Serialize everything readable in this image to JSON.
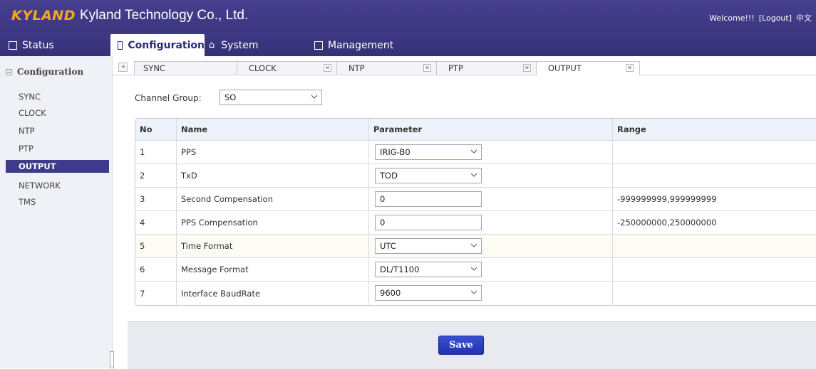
{
  "header": {
    "logo": "KYLAND",
    "company": "Kyland Technology Co., Ltd.",
    "welcome": "Welcome!!!",
    "logout": "[Logout]",
    "language": "中文"
  },
  "nav": {
    "tabs": [
      {
        "label": "Status",
        "icon": "status-icon"
      },
      {
        "label": "Configuration",
        "icon": "configuration-icon",
        "active": true
      },
      {
        "label": "System",
        "icon": "home-icon"
      },
      {
        "label": "Management",
        "icon": "management-icon"
      }
    ]
  },
  "sidebar": {
    "title": "Configuration",
    "items": [
      {
        "label": "SYNC"
      },
      {
        "label": "CLOCK"
      },
      {
        "label": "NTP"
      },
      {
        "label": "PTP"
      },
      {
        "label": "OUTPUT",
        "active": true
      },
      {
        "label": "NETWORK"
      },
      {
        "label": "TMS"
      }
    ]
  },
  "subtabs": [
    {
      "label": "SYNC"
    },
    {
      "label": "CLOCK"
    },
    {
      "label": "NTP"
    },
    {
      "label": "PTP"
    },
    {
      "label": "OUTPUT",
      "active": true
    }
  ],
  "content": {
    "channel_group_label": "Channel Group:",
    "channel_group_value": "SO",
    "table": {
      "headers": [
        "No",
        "Name",
        "Parameter",
        "Range"
      ],
      "rows": [
        {
          "no": "1",
          "name": "PPS",
          "type": "select",
          "value": "IRIG-B0",
          "range": ""
        },
        {
          "no": "2",
          "name": "TxD",
          "type": "select",
          "value": "TOD",
          "range": ""
        },
        {
          "no": "3",
          "name": "Second Compensation",
          "type": "input",
          "value": "0",
          "range": "-999999999,999999999"
        },
        {
          "no": "4",
          "name": "PPS Compensation",
          "type": "input",
          "value": "0",
          "range": "-250000000,250000000"
        },
        {
          "no": "5",
          "name": "Time Format",
          "type": "select",
          "value": "UTC",
          "range": ""
        },
        {
          "no": "6",
          "name": "Message Format",
          "type": "select",
          "value": "DL/T1100",
          "range": ""
        },
        {
          "no": "7",
          "name": "Interface BaudRate",
          "type": "select",
          "value": "9600",
          "range": ""
        }
      ]
    },
    "save_label": "Save"
  },
  "colors": {
    "header_bg": "#473f8e",
    "logo": "#f5a623",
    "active_item": "#3e3a8c",
    "save_button": "#2b3cc4"
  }
}
